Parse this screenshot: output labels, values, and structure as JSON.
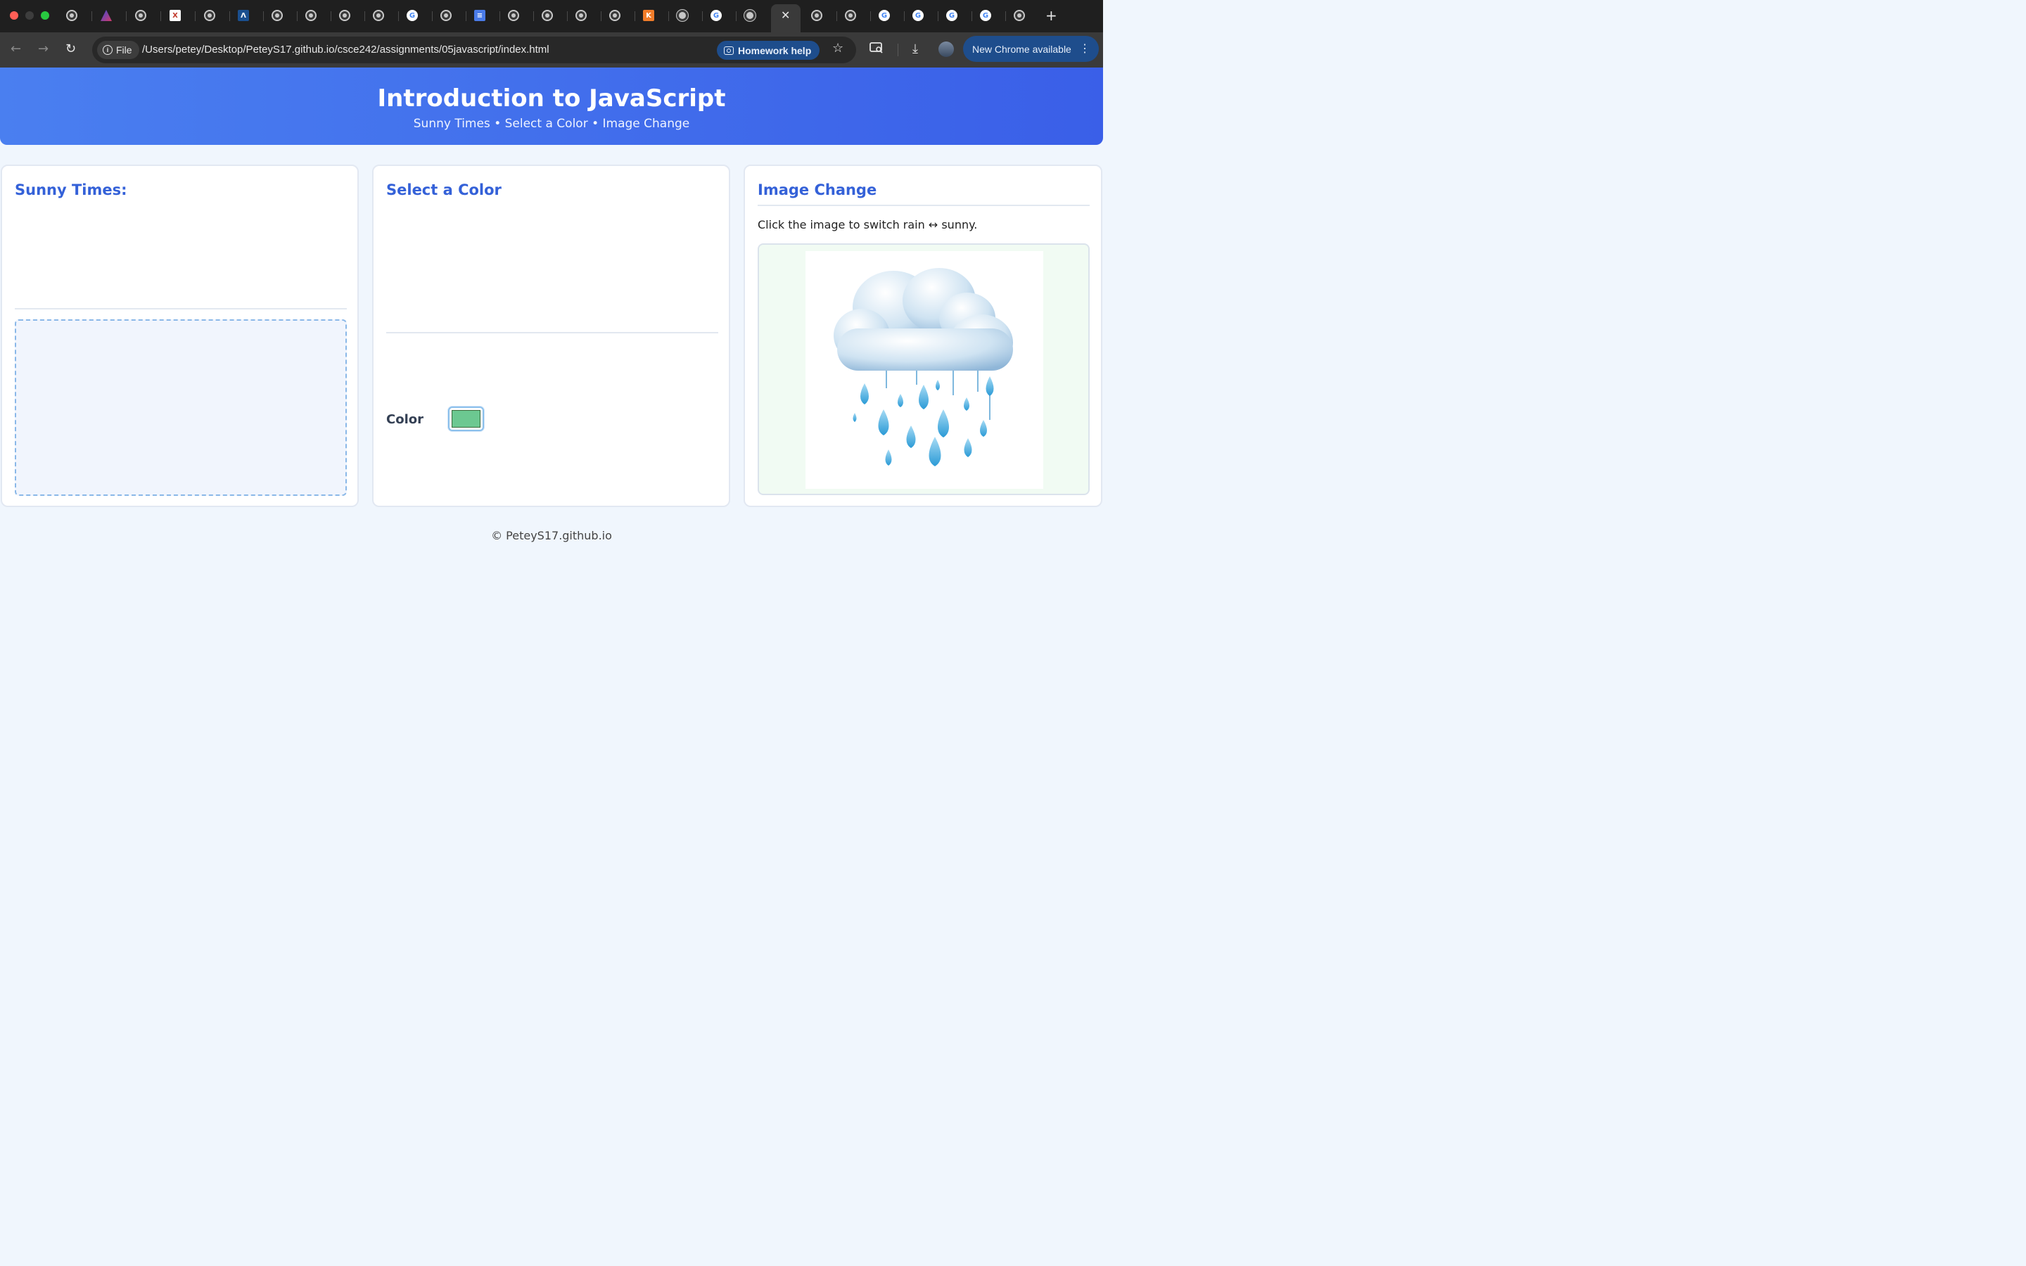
{
  "browser": {
    "active_tab_close": "✕",
    "new_tab": "+",
    "favicons": {
      "google": "G",
      "x_logo": "X",
      "a_logo": "Λ",
      "docs": "≡",
      "k_logo": "K"
    },
    "address_chip": "File",
    "url": "/Users/petey/Desktop/PeteyS17.github.io/csce242/assignments/05javascript/index.html",
    "homework_help": "Homework help",
    "update_label": "New Chrome available",
    "icons": {
      "back": "←",
      "forward": "→",
      "reload": "↻",
      "star": "☆",
      "downloads": "⤓",
      "menu": "⋮"
    }
  },
  "page": {
    "title": "Introduction to JavaScript",
    "subtitle": "Sunny Times • Select a Color • Image Change",
    "cards": [
      {
        "title": "Sunny Times:"
      },
      {
        "title": "Select a Color",
        "color_label": "Color",
        "color_value": "#6cc891"
      },
      {
        "title": "Image Change",
        "description": "Click the image to switch rain ↔ sunny."
      }
    ],
    "footer": "© PeteyS17.github.io"
  }
}
